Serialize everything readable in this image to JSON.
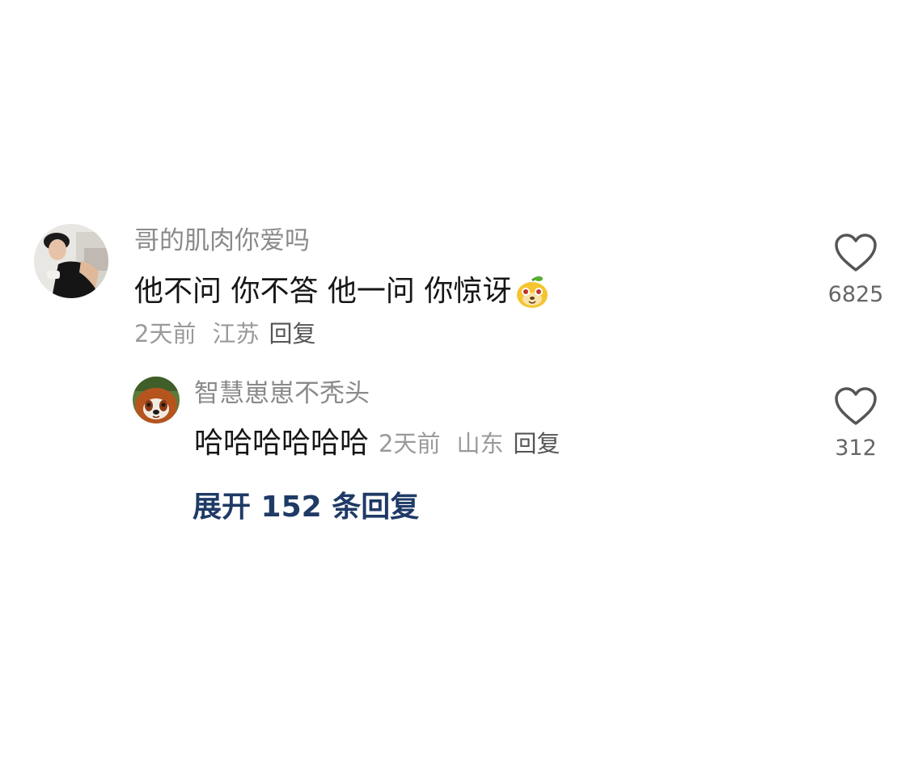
{
  "comment": {
    "username": "哥的肌肉你爱吗",
    "text": "他不问 你不答 他一问 你惊讶",
    "emoji_icon": "fruit-face-emoji",
    "time": "2天前",
    "location": "江苏",
    "reply_label": "回复",
    "like_count": "6825",
    "like_icon": "heart-outline-icon",
    "avatar": "man-black-tanktop-avatar"
  },
  "reply": {
    "username": "智慧崽崽不秃头",
    "text": "哈哈哈哈哈哈",
    "time": "2天前",
    "location": "山东",
    "reply_label": "回复",
    "like_count": "312",
    "like_icon": "heart-outline-icon",
    "avatar": "red-panda-avatar"
  },
  "expand_replies": {
    "label": "展开 152 条回复"
  },
  "colors": {
    "background": "#ffffff",
    "username": "#8a8a8a",
    "content": "#161616",
    "meta": "#9a9a9a",
    "expand_link": "#1f3a66",
    "heart_stroke": "#555555"
  }
}
